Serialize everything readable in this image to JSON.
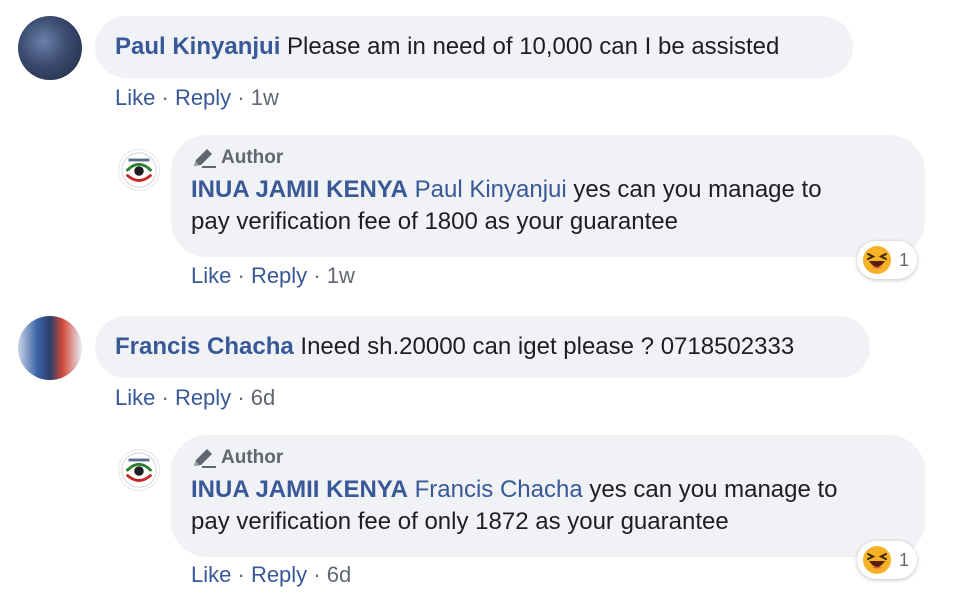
{
  "comments": [
    {
      "name": "Paul Kinyanjui",
      "text": "Please am in need of 10,000 can I be assisted",
      "like": "Like",
      "reply": "Reply",
      "time": "1w",
      "reply_comment": {
        "badge": "Author",
        "name": "INUA JAMII KENYA",
        "mention": "Paul Kinyanjui",
        "text_line1": "yes can you manage to",
        "text_line2": "pay verification fee of 1800 as your guarantee",
        "reaction": "laughing-emoji",
        "reaction_count": "1",
        "like": "Like",
        "reply": "Reply",
        "time": "1w"
      }
    },
    {
      "name": "Francis Chacha",
      "text": "Ineed sh.20000 can iget please ? 0718502333",
      "like": "Like",
      "reply": "Reply",
      "time": "6d",
      "reply_comment": {
        "badge": "Author",
        "name": "INUA JAMII KENYA",
        "mention": "Francis Chacha",
        "text_line1": "yes can you manage to",
        "text_line2": "pay verification fee of only 1872 as your guarantee",
        "reaction": "laughing-emoji",
        "reaction_count": "1",
        "like": "Like",
        "reply": "Reply",
        "time": "6d"
      }
    }
  ],
  "colors": {
    "link": "#385898",
    "bubble": "#f0f2f5",
    "meta": "#606770"
  }
}
